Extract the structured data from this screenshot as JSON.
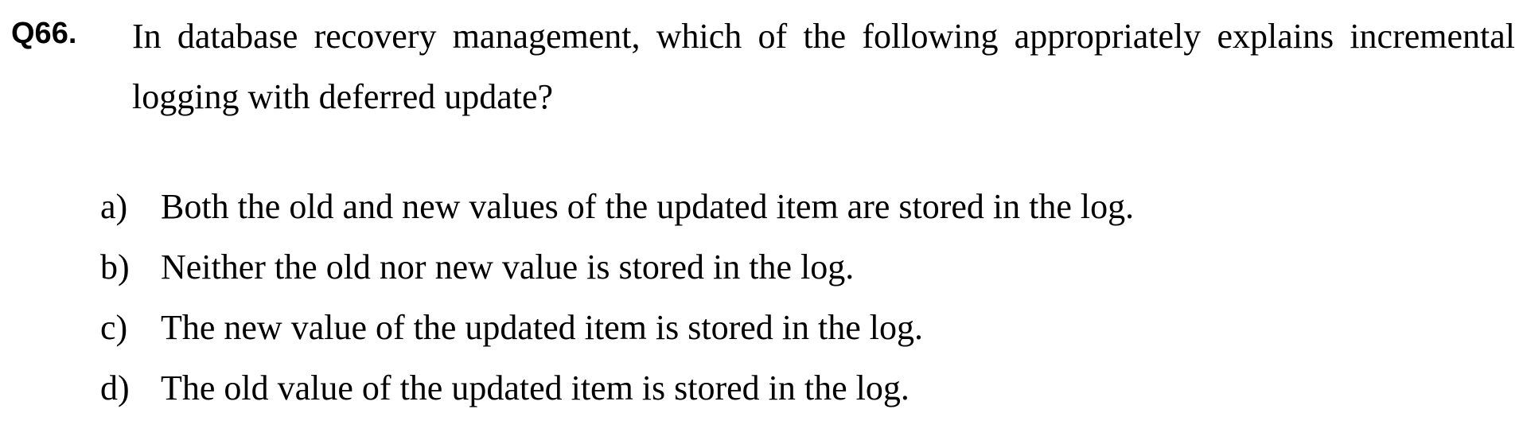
{
  "question": {
    "number": "Q66.",
    "text": "In database recovery management, which of the following appropriately explains incremental logging with deferred update?"
  },
  "options": [
    {
      "letter": "a)",
      "text": "Both the old and new values of the updated item are stored in the log."
    },
    {
      "letter": "b)",
      "text": "Neither the old nor new value is stored in the log."
    },
    {
      "letter": "c)",
      "text": "The new value of the updated item is stored in the log."
    },
    {
      "letter": "d)",
      "text": "The old value of the updated item is stored in the log."
    }
  ]
}
